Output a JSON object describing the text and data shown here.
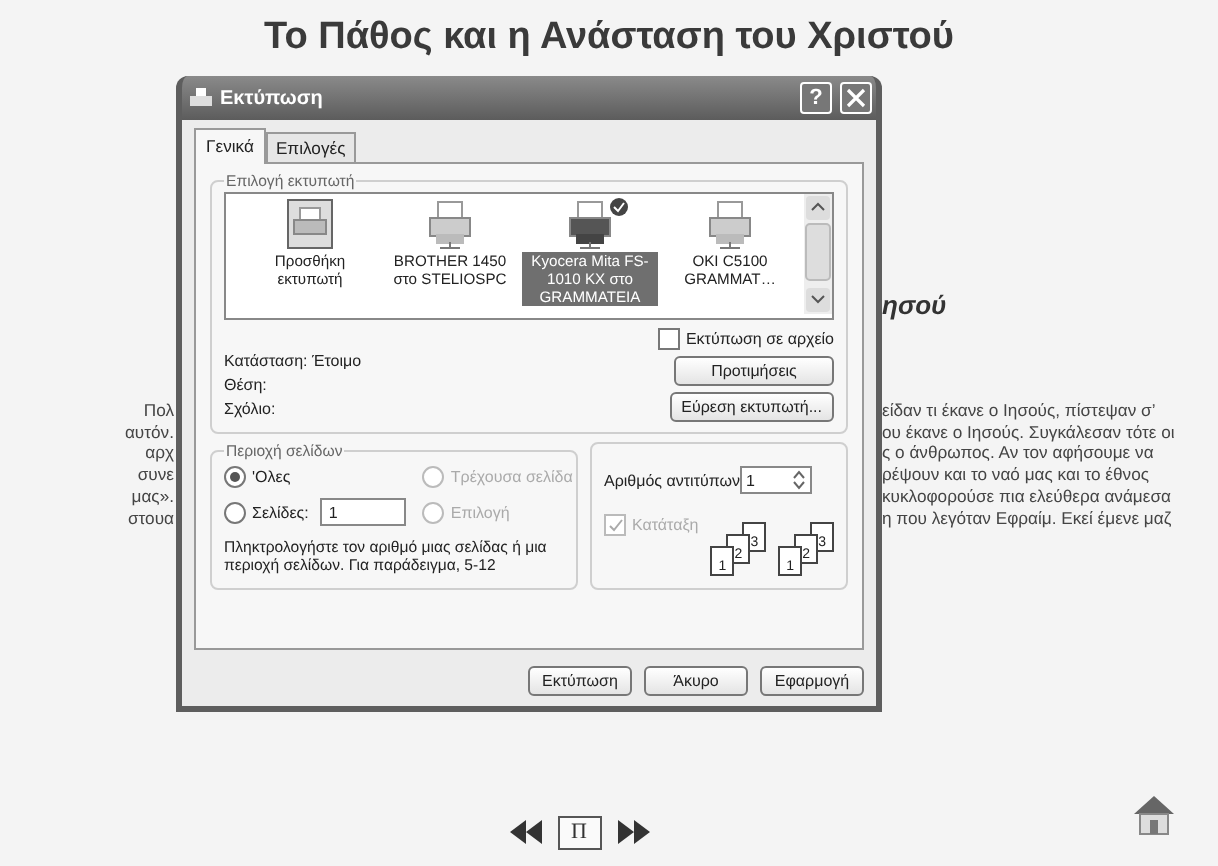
{
  "page": {
    "title": "Το Πάθος και η Ανάσταση του Χριστού",
    "heading_fragment": "ησού",
    "left_fragments": [
      "Πολ",
      "αυτόν.",
      "αρχ",
      "συνε",
      "μας».",
      "στουα"
    ],
    "right_fragments": [
      "είδαν τι έκανε ο Ιησούς, πίστεψαν σ’",
      "ου έκανε ο Ιησούς. Συγκάλεσαν τότε οι",
      "ς ο άνθρωπος. Αν τον αφήσουμε να",
      "ρέψουν και το ναό μας και το έθνος",
      "κυκλοφορούσε πια ελεύθερα ανάμεσα",
      "η που λεγόταν Εφραίμ. Εκεί έμενε μαζ"
    ],
    "nav": {
      "page_label": "Π"
    }
  },
  "dialog": {
    "title": "Εκτύπωση",
    "help": "?",
    "tabs": [
      {
        "label": "Γενικά",
        "selected": true
      },
      {
        "label": "Επιλογές",
        "selected": false
      }
    ],
    "printer_group": {
      "label": "Επιλογή εκτυπωτή",
      "printers": [
        {
          "name": "Προσθήκη εκτυπωτή",
          "kind": "add",
          "selected": false,
          "default": false
        },
        {
          "name": "BROTHER 1450 στο STELIOSPC",
          "kind": "printer",
          "selected": false,
          "default": false
        },
        {
          "name": "Kyocera Mita FS-1010 KX στο GRAMMATEIA",
          "kind": "printer",
          "selected": true,
          "default": true
        },
        {
          "name": "OKI C5100 GRAMMAT…",
          "kind": "printer",
          "selected": false,
          "default": false
        }
      ],
      "print_to_file": {
        "label": "Εκτύπωση σε αρχείο",
        "checked": false
      },
      "info": [
        {
          "label": "Κατάσταση:",
          "value": "Έτοιμο"
        },
        {
          "label": "Θέση:"
        },
        {
          "label": "Σχόλιο:"
        }
      ],
      "buttons": [
        "Προτιμήσεις",
        "Εύρεση εκτυπωτή..."
      ]
    },
    "page_range": {
      "label": "Περιοχή σελίδων",
      "options": [
        {
          "label": "'Ολες",
          "kind": "plain",
          "selected": true,
          "disabled": false
        },
        {
          "label": "Τρέχουσα σελίδα",
          "kind": "plain",
          "selected": false,
          "disabled": true
        },
        {
          "label": "Σελίδες:",
          "kind": "pages",
          "selected": false,
          "disabled": false,
          "value": "1"
        },
        {
          "label": "Επιλογή",
          "kind": "plain",
          "selected": false,
          "disabled": true
        }
      ],
      "hint": "Πληκτρολογήστε τον αριθμό μιας σελίδας ή μια περιοχή σελίδων.  Για παράδειγμα, 5-12"
    },
    "copies": {
      "label": "Αριθμός αντιτύπων",
      "value": "1",
      "collate": {
        "label": "Κατάταξη",
        "checked": true,
        "disabled": true
      },
      "illustrations": [
        {
          "pages": [
            "1",
            "2",
            "3"
          ]
        },
        {
          "pages": [
            "1",
            "2",
            "3"
          ]
        }
      ]
    },
    "buttons": [
      "Εκτύπωση",
      "Άκυρο",
      "Εφαρμογή"
    ]
  }
}
